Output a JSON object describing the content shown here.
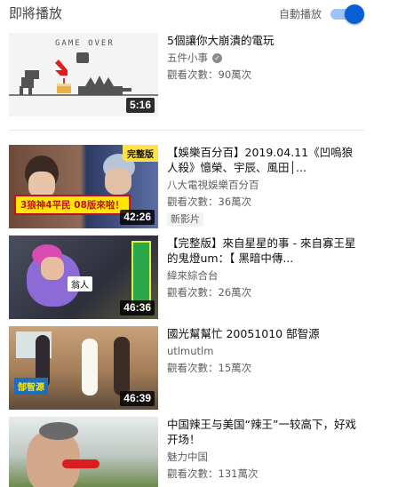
{
  "header": {
    "title": "即將播放",
    "autoplay_label": "自動播放",
    "autoplay_on": true,
    "accent_color": "#065fd4"
  },
  "videos": [
    {
      "title": "5個讓你大崩潰的電玩",
      "channel": "五件小事",
      "verified": true,
      "views": "觀看次數：90萬次",
      "duration": "5:16",
      "thumb_text": "GAME OVER",
      "badge": ""
    },
    {
      "title": "【娛樂百分百】2019.04.11《凹嗚狼人殺》憶榮、宇辰、風田│...",
      "channel": "八大電視娛樂百分百",
      "verified": false,
      "views": "觀看次數：36萬次",
      "duration": "42:26",
      "thumb_text": "3狼神4平民 08版來啦！",
      "thumb_corner": "完整版",
      "badge": "新影片"
    },
    {
      "title": "【完整版】來自星星的事 - 來自寡王星的鬼燈um：【 黑暗中傳...",
      "channel": "緯來綜合台",
      "verified": false,
      "views": "觀看次數：26萬次",
      "duration": "46:36",
      "thumb_text": "翁人",
      "badge": ""
    },
    {
      "title": "國光幫幫忙 20051010 郜智源",
      "channel": "utlmutlm",
      "verified": false,
      "views": "觀看次數：15萬次",
      "duration": "46:39",
      "thumb_text": "郜智源",
      "badge": ""
    },
    {
      "title": "中国辣王与美国“辣王”一较高下，好戏开场！",
      "channel": "魅力中国",
      "verified": false,
      "views": "觀看次數：131萬次",
      "duration": "",
      "thumb_text": "",
      "badge": ""
    }
  ]
}
